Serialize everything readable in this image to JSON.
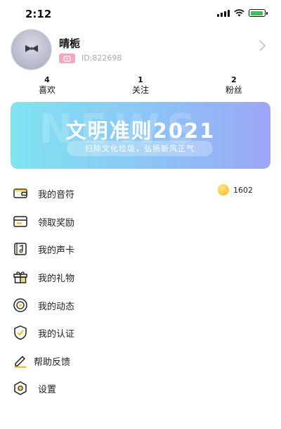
{
  "status_bar": {
    "time": "2:12"
  },
  "profile": {
    "name": "晴栀",
    "id_text": "ID:822698"
  },
  "stats": [
    {
      "count": "4",
      "label": "喜欢"
    },
    {
      "count": "1",
      "label": "关注"
    },
    {
      "count": "2",
      "label": "粉丝"
    }
  ],
  "banner": {
    "ghost_text": "NEWS",
    "title": "文明准则2021",
    "subtitle": "扫除文化垃圾，弘扬新风正气"
  },
  "wallet": {
    "coins": "1602"
  },
  "menu": [
    {
      "label": "我的音符",
      "icon": "wallet-icon"
    },
    {
      "label": "领取奖励",
      "icon": "reward-card-icon"
    },
    {
      "label": "我的声卡",
      "icon": "sound-card-icon"
    },
    {
      "label": "我的礼物",
      "icon": "gift-icon"
    },
    {
      "label": "我的动态",
      "icon": "disc-icon"
    },
    {
      "label": "我的认证",
      "icon": "shield-check-icon"
    },
    {
      "label": "帮助反馈",
      "icon": "pencil-icon"
    },
    {
      "label": "设置",
      "icon": "hexagon-settings-icon"
    }
  ],
  "colors": {
    "accent": "#f3a9bd",
    "coin": "#f2b818",
    "banner_start": "#7fe4f0",
    "banner_end": "#9da6f7"
  }
}
